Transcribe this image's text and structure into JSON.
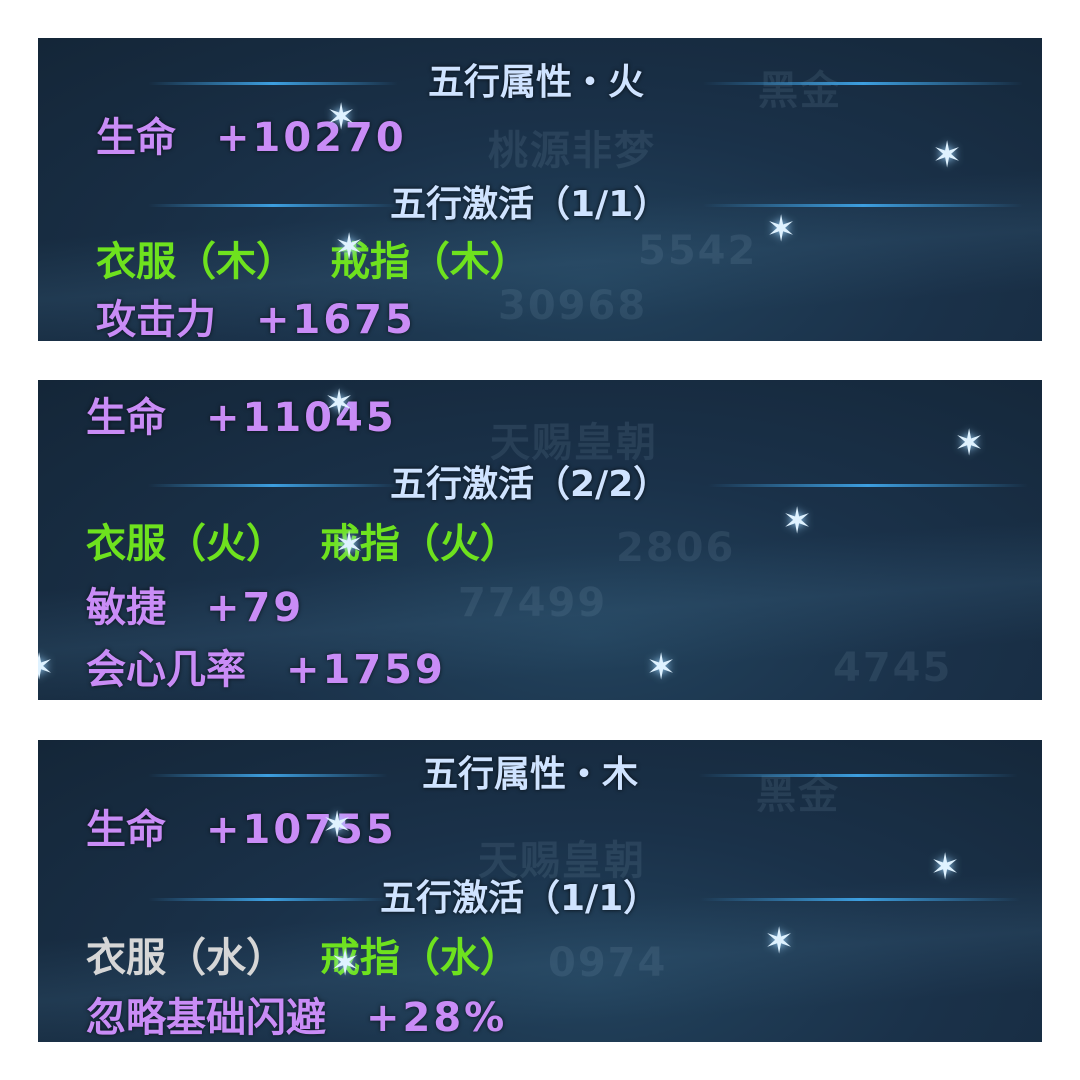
{
  "panels": [
    {
      "header": "五行属性・火",
      "health_label": "生命",
      "health_value": "+10270",
      "activation_header": "五行激活（1/1）",
      "items": [
        {
          "label": "衣服（木）",
          "active": true
        },
        {
          "label": "戒指（木）",
          "active": true
        }
      ],
      "bonuses": [
        {
          "label": "攻击力",
          "value": "+1675"
        }
      ],
      "ghost_texts": [
        "桃源非梦",
        "5542",
        "30968",
        "黑金"
      ]
    },
    {
      "health_label": "生命",
      "health_value": "+11045",
      "activation_header": "五行激活（2/2）",
      "items": [
        {
          "label": "衣服（火）",
          "active": true
        },
        {
          "label": "戒指（火）",
          "active": true
        }
      ],
      "bonuses": [
        {
          "label": "敏捷",
          "value": "+79"
        },
        {
          "label": "会心几率",
          "value": "+1759"
        }
      ],
      "ghost_texts": [
        "天赐皇朝",
        "2806",
        "77499",
        "4745"
      ]
    },
    {
      "header": "五行属性・木",
      "health_label": "生命",
      "health_value": "+10755",
      "activation_header": "五行激活（1/1）",
      "items": [
        {
          "label": "衣服（水）",
          "active": false
        },
        {
          "label": "戒指（水）",
          "active": true
        }
      ],
      "bonuses": [
        {
          "label": "忽略基础闪避",
          "value": "+28%"
        }
      ],
      "ghost_texts": [
        "天赐皇朝",
        "0974",
        "黑金"
      ]
    }
  ],
  "colors": {
    "bonus": "#c98cf6",
    "active": "#6ee21e",
    "inactive": "#d6d6d6",
    "header": "#cfe3ff",
    "divider": "#3d9fe0"
  },
  "icons": [
    "sparkle-icon"
  ]
}
